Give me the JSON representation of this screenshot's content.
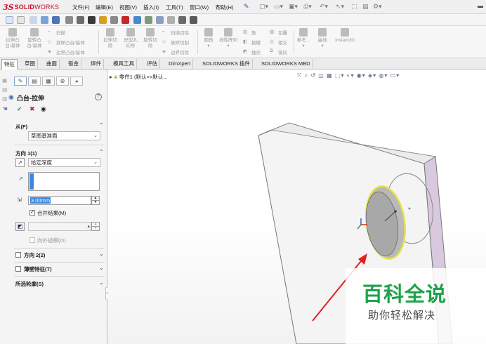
{
  "app": {
    "logo_ds": "3S",
    "logo_solid": "SOLID",
    "logo_works": "WORKS"
  },
  "menu": {
    "items": [
      "文件(F)",
      "编辑(E)",
      "视图(V)",
      "插入(I)",
      "工具(T)",
      "窗口(W)",
      "帮助(H)"
    ]
  },
  "features_toolbar": {
    "extrude_boss_top": "拉伸凸",
    "extrude_boss_bottom": "台/基体",
    "revolve_boss_top": "旋转凸",
    "revolve_boss_bottom": "台/基体",
    "sweep": "扫描",
    "loft_boss": "放样凸台/基体",
    "boundary_boss": "边界凸台/基体",
    "extrude_cut_top": "拉伸切",
    "extrude_cut_bottom": "除",
    "hole_wizard_top": "异型孔",
    "hole_wizard_bottom": "向导",
    "revolve_cut_top": "旋转切",
    "revolve_cut_bottom": "除",
    "sweep_cut": "扫描切除",
    "loft_cut": "放样切割",
    "boundary_cut": "边界切除",
    "fillet": "圆角",
    "linear_pattern": "线性阵列",
    "rib": "筋",
    "draft": "拔模",
    "shell": "抽壳",
    "wrap": "包覆",
    "intersect": "相交",
    "mirror": "镜向",
    "reference": "参考...",
    "curves": "曲线",
    "instant3d": "Instant3D"
  },
  "tabs": [
    "特征",
    "草图",
    "曲面",
    "钣金",
    "焊件",
    "模具工具",
    "评估",
    "DimXpert",
    "SOLIDWORKS 插件",
    "SOLIDWORKS MBD"
  ],
  "active_tab": "特征",
  "property_manager": {
    "title": "凸台-拉伸",
    "help_label": "?",
    "from": {
      "header": "从(F)",
      "value": "草图基准面"
    },
    "direction1": {
      "header": "方向 1(1)",
      "end_condition": "给定深度",
      "depth": "3.00mm",
      "merge_result_label": "合并结果(M)",
      "merge_result_checked": true,
      "draft_outward_label": "向外拔模(O)",
      "draft_outward_checked": false
    },
    "direction2": {
      "header": "方向 2(2)"
    },
    "thin_feature": {
      "header": "薄壁特征(T)"
    },
    "selected_contours": {
      "header": "所选轮廓(S)"
    }
  },
  "viewport": {
    "tree_root_label": "零件1 (默认<<默认..."
  },
  "watermark": {
    "title": "百科全说",
    "subtitle": "助你轻松解决"
  },
  "colors": {
    "brand_red": "#c8102e",
    "face_front": "#f4f4f4",
    "face_side": "#d9c9df",
    "face_top": "#ebebeb",
    "extrude_preview": "#e8e04a",
    "selection_blue": "#3a86e0",
    "watermark_green": "#1ea24a",
    "arrow_red": "#e02020"
  }
}
